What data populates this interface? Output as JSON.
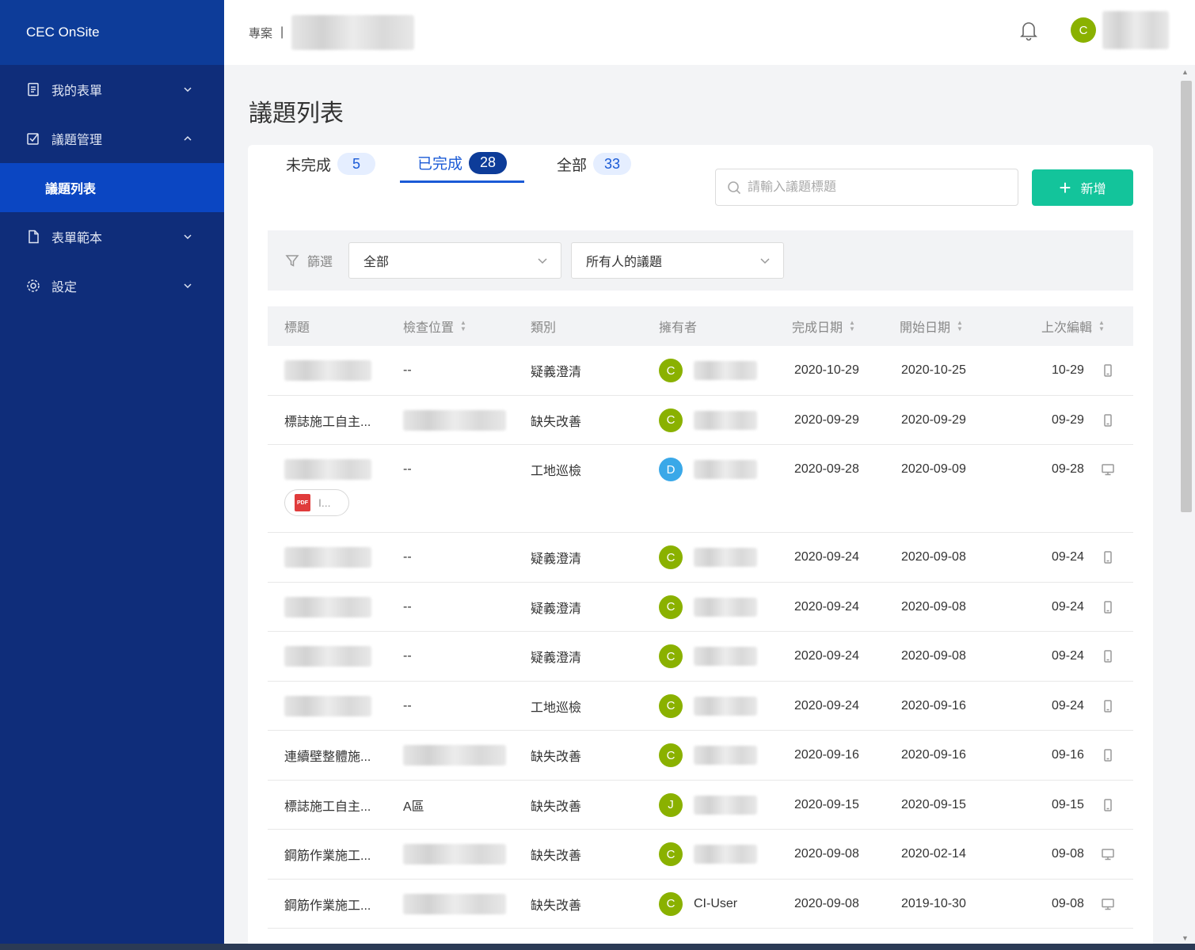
{
  "sidebar": {
    "brand": "CEC OnSite",
    "items": [
      {
        "label": "我的表單",
        "icon": "form-icon",
        "expanded": false
      },
      {
        "label": "議題管理",
        "icon": "checkbox-edit-icon",
        "expanded": true
      },
      {
        "label": "表單範本",
        "icon": "document-icon",
        "expanded": false
      },
      {
        "label": "設定",
        "icon": "gear-icon",
        "expanded": false
      }
    ],
    "sub_item": "議題列表"
  },
  "header": {
    "breadcrumb": "專案",
    "separator": "|",
    "avatar_letter": "C"
  },
  "page": {
    "title": "議題列表"
  },
  "tabs": [
    {
      "label": "未完成",
      "count": "5"
    },
    {
      "label": "已完成",
      "count": "28",
      "active": true
    },
    {
      "label": "全部",
      "count": "33"
    }
  ],
  "search": {
    "placeholder": "請輸入議題標題"
  },
  "add_button": {
    "label": "新增"
  },
  "filter": {
    "label": "篩選",
    "select1": "全部",
    "select2": "所有人的議題"
  },
  "table": {
    "headers": [
      "標題",
      "檢查位置",
      "類別",
      "擁有者",
      "完成日期",
      "開始日期",
      "上次編輯"
    ],
    "pdf_label": "I...",
    "rows": [
      {
        "title": "",
        "location": "--",
        "category": "疑義澄清",
        "owner_letter": "C",
        "owner_color": "#8ab100",
        "owner_name": "",
        "done": "2020-10-29",
        "start": "2020-10-25",
        "edited": "10-29",
        "device": "mobile-icon"
      },
      {
        "title": "標誌施工自主...",
        "location": "",
        "category": "缺失改善",
        "owner_letter": "C",
        "owner_color": "#8ab100",
        "owner_name": "",
        "done": "2020-09-29",
        "start": "2020-09-29",
        "edited": "09-29",
        "device": "mobile-icon"
      },
      {
        "title": "",
        "location": "--",
        "category": "工地巡檢",
        "owner_letter": "D",
        "owner_color": "#3aa8e8",
        "owner_name": "",
        "done": "2020-09-28",
        "start": "2020-09-09",
        "edited": "09-28",
        "device": "desktop-icon",
        "has_pdf": true
      },
      {
        "title": "",
        "location": "--",
        "category": "疑義澄清",
        "owner_letter": "C",
        "owner_color": "#8ab100",
        "owner_name": "",
        "done": "2020-09-24",
        "start": "2020-09-08",
        "edited": "09-24",
        "device": "mobile-icon"
      },
      {
        "title": "",
        "location": "--",
        "category": "疑義澄清",
        "owner_letter": "C",
        "owner_color": "#8ab100",
        "owner_name": "",
        "done": "2020-09-24",
        "start": "2020-09-08",
        "edited": "09-24",
        "device": "mobile-icon"
      },
      {
        "title": "",
        "location": "--",
        "category": "疑義澄清",
        "owner_letter": "C",
        "owner_color": "#8ab100",
        "owner_name": "",
        "done": "2020-09-24",
        "start": "2020-09-08",
        "edited": "09-24",
        "device": "mobile-icon"
      },
      {
        "title": "",
        "location": "--",
        "category": "工地巡檢",
        "owner_letter": "C",
        "owner_color": "#8ab100",
        "owner_name": "",
        "done": "2020-09-24",
        "start": "2020-09-16",
        "edited": "09-24",
        "device": "mobile-icon"
      },
      {
        "title": "連續壁整體施...",
        "location": "",
        "category": "缺失改善",
        "owner_letter": "C",
        "owner_color": "#8ab100",
        "owner_name": "",
        "done": "2020-09-16",
        "start": "2020-09-16",
        "edited": "09-16",
        "device": "mobile-icon"
      },
      {
        "title": "標誌施工自主...",
        "location": "A區",
        "category": "缺失改善",
        "owner_letter": "J",
        "owner_color": "#8ab100",
        "owner_name": "",
        "done": "2020-09-15",
        "start": "2020-09-15",
        "edited": "09-15",
        "device": "mobile-icon"
      },
      {
        "title": "鋼筋作業施工...",
        "location": "",
        "category": "缺失改善",
        "owner_letter": "C",
        "owner_color": "#8ab100",
        "owner_name": "",
        "done": "2020-09-08",
        "start": "2020-02-14",
        "edited": "09-08",
        "device": "desktop-icon"
      },
      {
        "title": "鋼筋作業施工...",
        "location": "",
        "category": "缺失改善",
        "owner_letter": "C",
        "owner_color": "#8ab100",
        "owner_name": "CI-User",
        "done": "2020-09-08",
        "start": "2019-10-30",
        "edited": "09-08",
        "device": "desktop-icon"
      }
    ]
  },
  "colors": {
    "sidebar_bg": "#0f2d7a",
    "active_nav": "#0b46c2",
    "primary": "#1a5ad6",
    "add_button": "#13c49b"
  }
}
